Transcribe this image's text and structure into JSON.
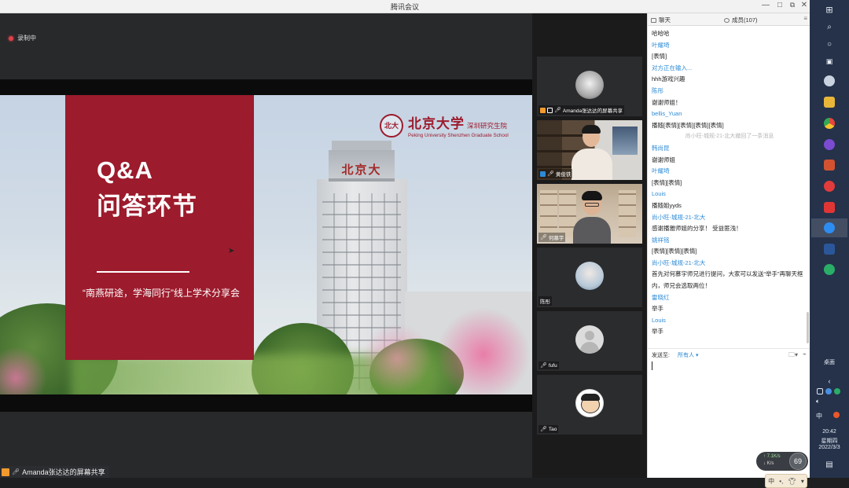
{
  "window": {
    "title": "腾讯会议"
  },
  "stage": {
    "recording_label": "录制中",
    "share_label": "Amanda张达达的屏幕共享"
  },
  "slide": {
    "title_line1": "Q&A",
    "title_line2": "问答环节",
    "subtitle": "“南燕研途，学海同行”线上学术分享会",
    "logo_cn": "北京大学",
    "logo_sub": "深圳研究生院",
    "logo_en": "Peking University Shenzhen Graduate School",
    "tower_sign": "北京大"
  },
  "participants": [
    {
      "name": "Amanda张达达的屏幕共享",
      "avatar": "cat-avatar"
    },
    {
      "name": "黄俊铁",
      "avatar": "camera"
    },
    {
      "name": "何慕宇",
      "avatar": "camera"
    },
    {
      "name": "陈彤",
      "avatar": "photo-avatar"
    },
    {
      "name": "fufu",
      "avatar": "default-avatar"
    },
    {
      "name": "Tao",
      "avatar": "cartoon-avatar"
    }
  ],
  "chat": {
    "tab_chat": "聊天",
    "tab_members": "成员(107)",
    "messages": [
      {
        "kind": "text",
        "text": "哈哈哈"
      },
      {
        "kind": "name",
        "text": "叶耀埼"
      },
      {
        "kind": "text",
        "text": "[表情]"
      },
      {
        "kind": "name",
        "text": "对方正在输入..."
      },
      {
        "kind": "text",
        "text": "hhh游戏兴趣"
      },
      {
        "kind": "name",
        "text": "陈彤"
      },
      {
        "kind": "text",
        "text": "谢谢师姐！"
      },
      {
        "kind": "name",
        "text": "bellis_Yuan"
      },
      {
        "kind": "text",
        "text": "播随[表情][表情][表情][表情]"
      },
      {
        "kind": "sys",
        "text": "尚小旺-城规-21-北大撤回了一条消息"
      },
      {
        "kind": "name",
        "text": "韩尚昆"
      },
      {
        "kind": "text",
        "text": "谢谢师姐"
      },
      {
        "kind": "name",
        "text": "叶耀埼"
      },
      {
        "kind": "text",
        "text": "[表情][表情]"
      },
      {
        "kind": "name",
        "text": "Louis"
      },
      {
        "kind": "text",
        "text": "播随姐yyds"
      },
      {
        "kind": "name",
        "text": "尚小旺-城规-21-北大"
      },
      {
        "kind": "text",
        "text": "感谢播雅师姐的分享！ 受益匪浅！"
      },
      {
        "kind": "name",
        "text": "姚祥铭"
      },
      {
        "kind": "text",
        "text": "[表情][表情][表情]"
      },
      {
        "kind": "name",
        "text": "尚小旺-城规-21-北大"
      },
      {
        "kind": "wrap",
        "text": "首先对何慕宇师兄进行提问，大家可以发送“举手”再聊天框内，师兄会选取两位！"
      },
      {
        "kind": "name",
        "text": "雷晓红"
      },
      {
        "kind": "text",
        "text": "举手"
      },
      {
        "kind": "name",
        "text": "Louis"
      },
      {
        "kind": "text",
        "text": "举手"
      }
    ],
    "send_to_label": "发送至:",
    "send_to_value": "所有人",
    "net_up": "7.1K/s",
    "net_down": "K/s",
    "net_score": "69",
    "ime_label": "中"
  },
  "taskbar": {
    "desktop_label": "桌面",
    "ime": "中",
    "time": "20:42",
    "weekday": "星期四",
    "date": "2022/3/3"
  },
  "colors": {
    "accent_red": "#9c1b2c",
    "link_blue": "#2c8ad6",
    "taskbar": "#25324a"
  }
}
